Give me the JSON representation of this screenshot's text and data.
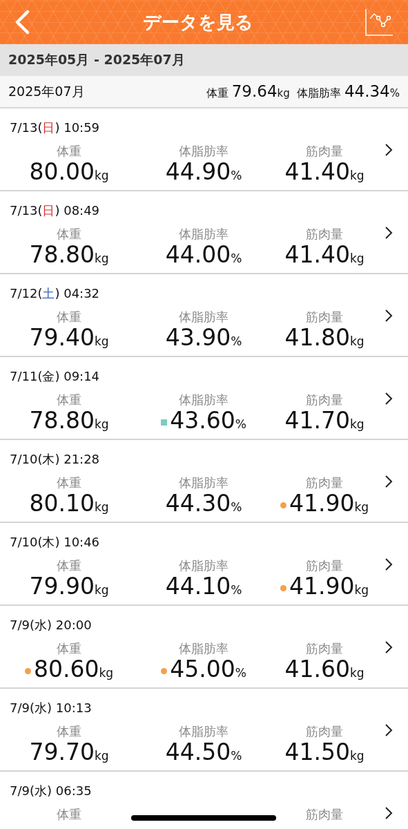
{
  "header": {
    "title": "データを見る"
  },
  "range": {
    "label": "2025年05月 - 2025年07月"
  },
  "summary": {
    "month": "2025年07月",
    "stats": [
      {
        "label": "体重",
        "value": "79.64",
        "unit": "kg"
      },
      {
        "label": "体脂肪率",
        "value": "44.34",
        "unit": "%"
      }
    ]
  },
  "records": [
    {
      "date_prefix": "7/13(",
      "weekday": {
        "label": "日",
        "color": "#d0312d"
      },
      "date_suffix": ") 10:59",
      "metrics": [
        {
          "label": "体重",
          "value": "80.00",
          "unit": "kg"
        },
        {
          "label": "体脂肪率",
          "value": "44.90",
          "unit": "%"
        },
        {
          "label": "筋肉量",
          "value": "41.40",
          "unit": "kg"
        }
      ]
    },
    {
      "date_prefix": "7/13(",
      "weekday": {
        "label": "日",
        "color": "#d0312d"
      },
      "date_suffix": ") 08:49",
      "metrics": [
        {
          "label": "体重",
          "value": "78.80",
          "unit": "kg"
        },
        {
          "label": "体脂肪率",
          "value": "44.00",
          "unit": "%"
        },
        {
          "label": "筋肉量",
          "value": "41.40",
          "unit": "kg"
        }
      ]
    },
    {
      "date_prefix": "7/12(",
      "weekday": {
        "label": "土",
        "color": "#3a63c4"
      },
      "date_suffix": ") 04:32",
      "metrics": [
        {
          "label": "体重",
          "value": "79.40",
          "unit": "kg"
        },
        {
          "label": "体脂肪率",
          "value": "43.90",
          "unit": "%"
        },
        {
          "label": "筋肉量",
          "value": "41.80",
          "unit": "kg"
        }
      ]
    },
    {
      "date_prefix": "7/11(",
      "weekday": {
        "label": "金",
        "color": "#111111"
      },
      "date_suffix": ") 09:14",
      "metrics": [
        {
          "label": "体重",
          "value": "78.80",
          "unit": "kg"
        },
        {
          "label": "体脂肪率",
          "value": "43.60",
          "unit": "%",
          "marker": {
            "kind": "square",
            "color": "#7ecbbc"
          }
        },
        {
          "label": "筋肉量",
          "value": "41.70",
          "unit": "kg"
        }
      ]
    },
    {
      "date_prefix": "7/10(",
      "weekday": {
        "label": "木",
        "color": "#111111"
      },
      "date_suffix": ") 21:28",
      "metrics": [
        {
          "label": "体重",
          "value": "80.10",
          "unit": "kg"
        },
        {
          "label": "体脂肪率",
          "value": "44.30",
          "unit": "%"
        },
        {
          "label": "筋肉量",
          "value": "41.90",
          "unit": "kg",
          "marker": {
            "kind": "dot",
            "color": "#f5a04a"
          }
        }
      ]
    },
    {
      "date_prefix": "7/10(",
      "weekday": {
        "label": "木",
        "color": "#111111"
      },
      "date_suffix": ") 10:46",
      "metrics": [
        {
          "label": "体重",
          "value": "79.90",
          "unit": "kg"
        },
        {
          "label": "体脂肪率",
          "value": "44.10",
          "unit": "%"
        },
        {
          "label": "筋肉量",
          "value": "41.90",
          "unit": "kg",
          "marker": {
            "kind": "dot",
            "color": "#f5a04a"
          }
        }
      ]
    },
    {
      "date_prefix": "7/9(",
      "weekday": {
        "label": "水",
        "color": "#111111"
      },
      "date_suffix": ") 20:00",
      "metrics": [
        {
          "label": "体重",
          "value": "80.60",
          "unit": "kg",
          "marker": {
            "kind": "dot",
            "color": "#f5a04a"
          }
        },
        {
          "label": "体脂肪率",
          "value": "45.00",
          "unit": "%",
          "marker": {
            "kind": "dot",
            "color": "#f5a04a"
          }
        },
        {
          "label": "筋肉量",
          "value": "41.60",
          "unit": "kg"
        }
      ]
    },
    {
      "date_prefix": "7/9(",
      "weekday": {
        "label": "水",
        "color": "#111111"
      },
      "date_suffix": ") 10:13",
      "metrics": [
        {
          "label": "体重",
          "value": "79.70",
          "unit": "kg"
        },
        {
          "label": "体脂肪率",
          "value": "44.50",
          "unit": "%"
        },
        {
          "label": "筋肉量",
          "value": "41.50",
          "unit": "kg"
        }
      ]
    },
    {
      "date_prefix": "7/9(",
      "weekday": {
        "label": "水",
        "color": "#111111"
      },
      "date_suffix": ") 06:35",
      "metrics": [
        {
          "label": "体重"
        },
        {
          "label": "筋肉量"
        }
      ]
    }
  ]
}
